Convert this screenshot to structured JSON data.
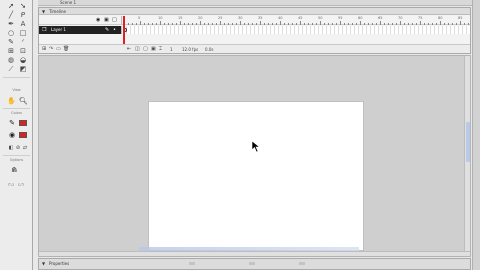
{
  "scene": {
    "label": "Scene 1"
  },
  "timeline": {
    "title": "Timeline",
    "layer_name": "Layer 1",
    "frame_numbers": [
      "5",
      "10",
      "15",
      "20",
      "25",
      "30",
      "35",
      "40",
      "45",
      "50",
      "55",
      "60",
      "65",
      "70",
      "75",
      "80",
      "85",
      "90",
      "95"
    ],
    "footer": {
      "frame": "1",
      "fps": "12.0 fps",
      "time": "0.0s"
    }
  },
  "tools": {
    "view_label": "View",
    "colors_label": "Colors",
    "options_label": "Options"
  },
  "properties": {
    "title": "Properties"
  },
  "colors": {
    "stroke": "#000000",
    "fill": "#e02020",
    "playhead": "#e02020"
  }
}
